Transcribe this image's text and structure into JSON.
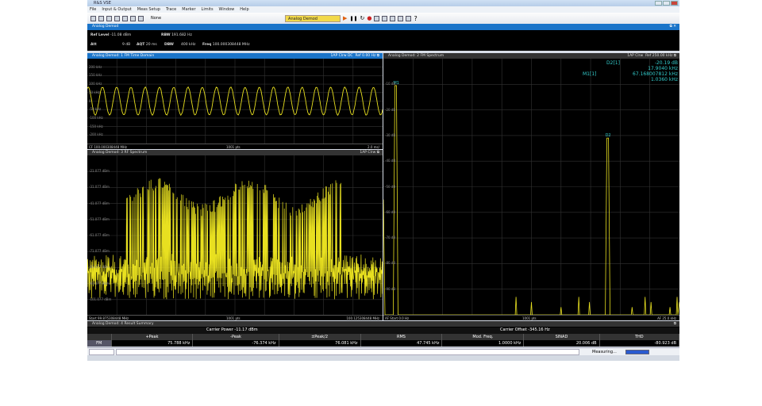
{
  "window": {
    "title": "R&S VSE"
  },
  "menu": [
    "File",
    "Input & Output",
    "Meas Setup",
    "Trace",
    "Marker",
    "Limits",
    "Window",
    "Help"
  ],
  "toolbar": {
    "none_label": "None",
    "mode_select": "Analog Demod"
  },
  "channel": {
    "title": "Analog Demod",
    "info": {
      "ref_level_label": "Ref Level",
      "ref_level": "-11.08 dBm",
      "att_label": "Att",
      "att": "9 dB",
      "aqt_label": "AQT",
      "aqt": "20 ms",
      "rbw_label": "RBW",
      "rbw": "191.682 Hz",
      "dbw_label": "DBW",
      "dbw": "400 kHz",
      "freq_label": "Freq",
      "freq": "100.000308448 MHz"
    }
  },
  "panel1": {
    "title": "Analog Demod: 1 FM Time Domain",
    "trace": "1AP Clrw DC",
    "ref": "Ref 0.00 Hz",
    "y_ticks": [
      "200 kHz",
      "150 kHz",
      "100 kHz",
      "50 kHz",
      "0",
      "-50 kHz",
      "-100 kHz",
      "-150 kHz",
      "-200 kHz"
    ],
    "footer_left": "CF 100.000308448 MHz",
    "footer_mid": "1001 pts",
    "footer_right": "2.0 ms/",
    "signal": {
      "amplitude_khz": 76,
      "cycles": 20.7,
      "ylim": [
        -250,
        250
      ]
    }
  },
  "panel3": {
    "title": "Analog Demod: 3 RF Spectrum",
    "trace": "1AP Clrw",
    "y_ticks": [
      "-21.077 dBm",
      "-31.077 dBm",
      "-41.077 dBm",
      "-51.077 dBm",
      "-61.077 dBm",
      "-71.077 dBm",
      "-81.077 dBm",
      "-91.077 dBm",
      "-101.077 dBm"
    ],
    "footer_left": "Start 99.875308448 MHz",
    "footer_mid": "1001 pts",
    "footer_right": "100.125308448 MHz"
  },
  "panel2": {
    "title": "Analog Demod: 2 FM Spectrum",
    "trace": "1AP Clrw",
    "ref": "Ref 250.00 kHz",
    "y_ticks": [
      "-10 dB",
      "-20 dB",
      "-30 dB",
      "-40 dB",
      "-50 dB",
      "-60 dB",
      "-70 dB",
      "-80 dB",
      "-90 dB"
    ],
    "markers": [
      {
        "name": "D2[1]",
        "v1": "-20.19 dB",
        "v2": "17.9040 kHz"
      },
      {
        "name": "M1[1]",
        "v1": "67.168007812 kHz",
        "v2": "1.0360 kHz"
      }
    ],
    "marker_labels": {
      "m1": "M1",
      "d2": "D2"
    },
    "peaks": [
      {
        "khz": 1.036,
        "db": -10.5
      },
      {
        "khz": 18.94,
        "db": -31
      }
    ],
    "xlim_khz": [
      0,
      25
    ],
    "ylim_db": [
      -100,
      0
    ],
    "footer_left": "AF Start 0.0 Hz",
    "footer_mid": "1001 pts",
    "footer_right": "AF 25.0 kHz"
  },
  "summary": {
    "title": "Analog Demod: 4 Result Summary",
    "carrier_power": "Carrier Power  -11.17 dBm",
    "carrier_offset": "Carrier Offset  -345.16 Hz",
    "headers": [
      "",
      "+Peak",
      "-Peak",
      "±Peak/2",
      "RMS",
      "Mod. Freq.",
      "SINAD",
      "THD"
    ],
    "row": [
      "FM",
      "75.788 kHz",
      "-76.374 kHz",
      "76.081 kHz",
      "47.745 kHz",
      "1.0000 kHz",
      "20.006 dB",
      "-80.923 dB"
    ]
  },
  "status": {
    "text": "Measuring...",
    "progress": 1.0
  },
  "colors": {
    "trace": "#e8e020",
    "marker": "#33cccc",
    "accent": "#1a74c9"
  }
}
